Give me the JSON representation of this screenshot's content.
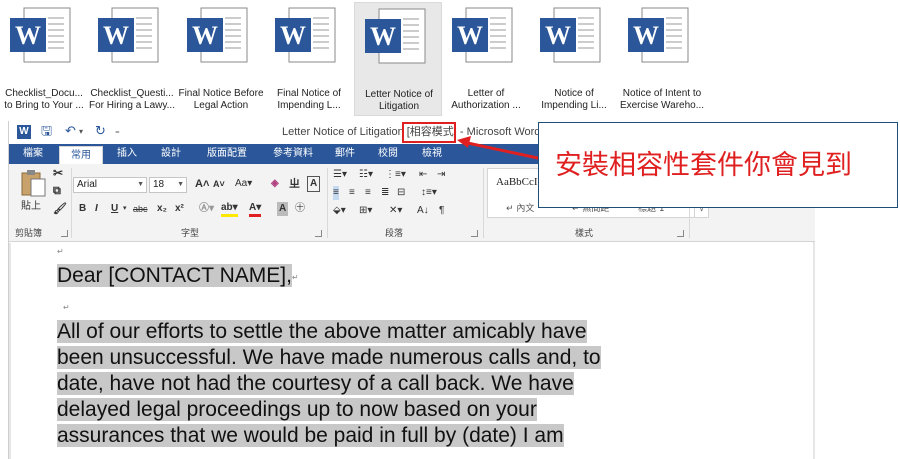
{
  "files": [
    {
      "label": "Checklist_Docu...\nto Bring to Your ..."
    },
    {
      "label": "Checklist_Questi...\nFor Hiring a Lawy..."
    },
    {
      "label": "Final Notice Before\nLegal Action"
    },
    {
      "label": "Final Notice of\nImpending L..."
    },
    {
      "label": "Letter Notice of\nLitigation"
    },
    {
      "label": "Letter of\nAuthorization ..."
    },
    {
      "label": "Notice of\nImpending Li..."
    },
    {
      "label": "Notice of Intent to\nExercise Wareho..."
    }
  ],
  "window": {
    "title": "Letter Notice of Litigation ",
    "compat_mode": "[相容模式]",
    "app_suffix": " - Microsoft Word",
    "tabs": [
      "檔案",
      "常用",
      "插入",
      "設計",
      "版面配置",
      "參考資料",
      "郵件",
      "校閱",
      "檢視"
    ],
    "active_tab_index": 1
  },
  "ribbon": {
    "clipboard": {
      "paste_label": "貼上",
      "group": "剪貼簿"
    },
    "font": {
      "name": "Arial",
      "size": "18",
      "group": "字型"
    },
    "paragraph": {
      "group": "段落"
    },
    "styles": {
      "sample": "AaBbCcI",
      "names": [
        "↵ 內文",
        "↵ 無間距",
        "標題 1"
      ],
      "group": "樣式"
    }
  },
  "document": {
    "greeting": "Dear [CONTACT NAME],",
    "body_lines": [
      "All of our efforts to settle the above matter amicably have",
      "been unsuccessful. We have made numerous calls and, to",
      "date, have not had the courtesy of a call back. We have",
      "delayed legal proceedings up to now based on your",
      "assurances that we would be paid in full by (date) I am"
    ]
  },
  "callout": {
    "text": "安裝相容性套件你會見到",
    "color": "#e02020"
  },
  "colors": {
    "word_blue": "#2b579a",
    "highlight": "#c8c8c8"
  }
}
